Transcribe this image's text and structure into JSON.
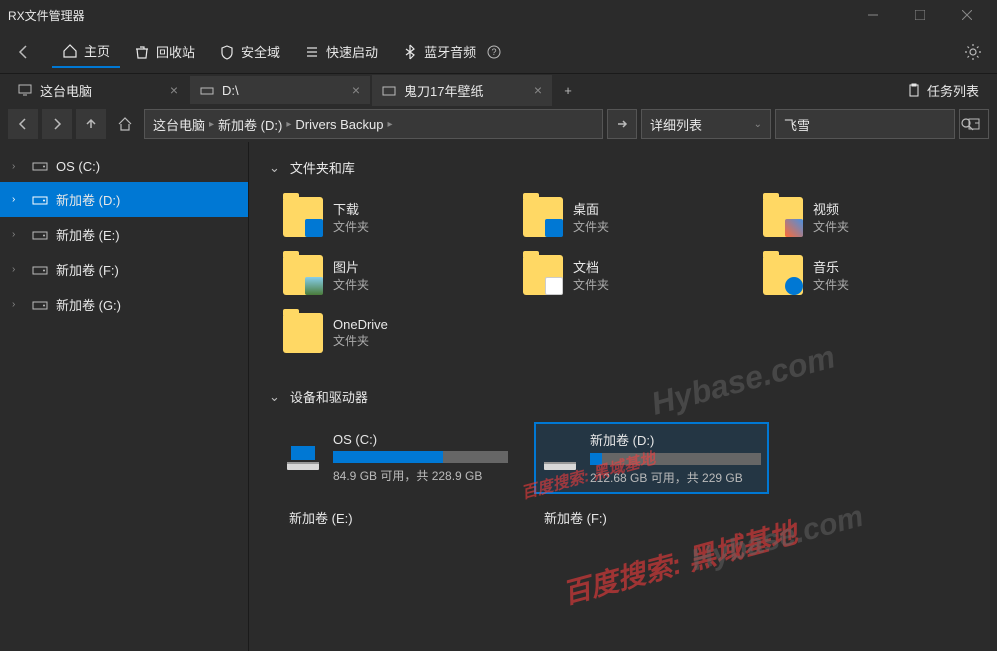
{
  "window": {
    "title": "RX文件管理器"
  },
  "menubar": {
    "home": "主页",
    "recycle": "回收站",
    "safezone": "安全域",
    "quicklaunch": "快速启动",
    "bluetooth": "蓝牙音频"
  },
  "tabs": [
    {
      "label": "这台电脑"
    },
    {
      "label": "D:\\"
    },
    {
      "label": "鬼刀17年壁纸"
    }
  ],
  "tasklist": "任务列表",
  "breadcrumb": {
    "parts": [
      "这台电脑",
      "新加卷 (D:)",
      "Drivers Backup"
    ]
  },
  "view_mode": "详细列表",
  "search": {
    "value": "飞雪"
  },
  "sidebar": {
    "items": [
      {
        "label": "OS (C:)",
        "active": false
      },
      {
        "label": "新加卷 (D:)",
        "active": true
      },
      {
        "label": "新加卷 (E:)",
        "active": false
      },
      {
        "label": "新加卷 (F:)",
        "active": false
      },
      {
        "label": "新加卷 (G:)",
        "active": false
      }
    ]
  },
  "sections": {
    "folders_title": "文件夹和库",
    "drives_title": "设备和驱动器"
  },
  "folders": [
    {
      "name": "下载",
      "type": "文件夹",
      "overlay": "download"
    },
    {
      "name": "桌面",
      "type": "文件夹",
      "overlay": "desktop"
    },
    {
      "name": "视频",
      "type": "文件夹",
      "overlay": "video"
    },
    {
      "name": "图片",
      "type": "文件夹",
      "overlay": "pictures"
    },
    {
      "name": "文档",
      "type": "文件夹",
      "overlay": "doc"
    },
    {
      "name": "音乐",
      "type": "文件夹",
      "overlay": "music"
    },
    {
      "name": "OneDrive",
      "type": "文件夹",
      "overlay": ""
    }
  ],
  "drives": [
    {
      "name": "OS (C:)",
      "info": "84.9 GB 可用，共 228.9 GB",
      "fill": 63,
      "selected": false,
      "os": true
    },
    {
      "name": "新加卷 (D:)",
      "info": "212.68 GB 可用，共 229 GB",
      "fill": 7,
      "selected": true,
      "os": false
    }
  ],
  "drive_labels": [
    {
      "name": "新加卷 (E:)"
    },
    {
      "name": "新加卷 (F:)"
    }
  ],
  "watermarks": {
    "text1": "百度搜索: 黑域基地",
    "text2": "Hybase.com",
    "text3": "百度搜索: 黑域基地",
    "text4": "Hybase.com"
  }
}
